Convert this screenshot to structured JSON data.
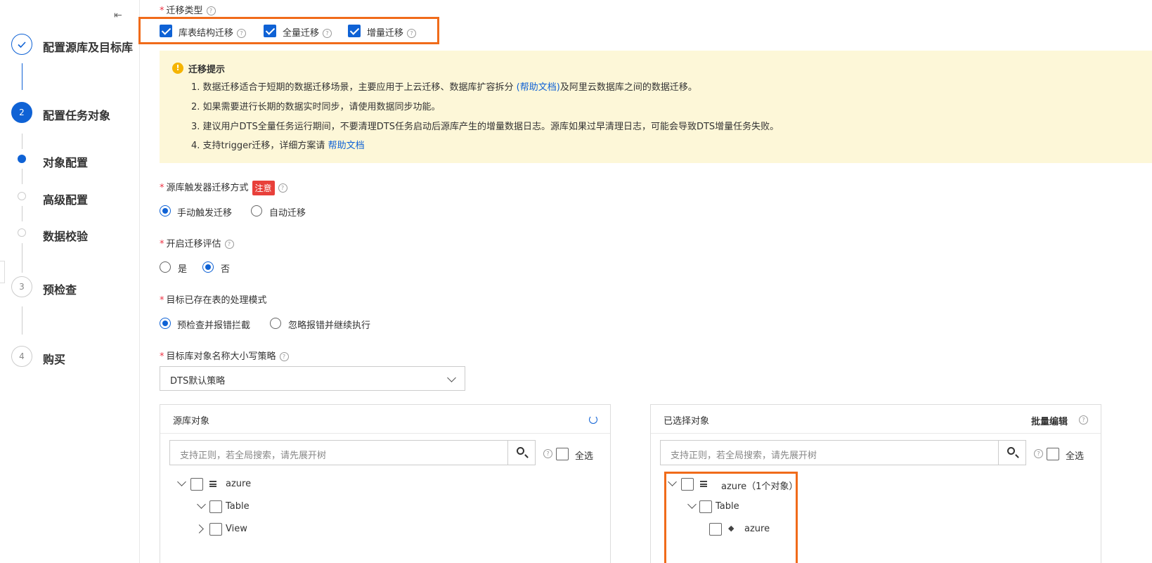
{
  "steps": {
    "step1": {
      "label": "配置源库及目标库",
      "icon": "check-icon"
    },
    "step2": {
      "number": "2",
      "label": "配置任务对象"
    },
    "sub1": {
      "label": "对象配置"
    },
    "sub2": {
      "label": "高级配置"
    },
    "sub3": {
      "label": "数据校验"
    },
    "step3": {
      "number": "3",
      "label": "预检查"
    },
    "step4": {
      "number": "4",
      "label": "购买"
    }
  },
  "collapse_icon": "⇤",
  "migration_type": {
    "label": "迁移类型",
    "options": [
      {
        "label": "库表结构迁移",
        "checked": true
      },
      {
        "label": "全量迁移",
        "checked": true
      },
      {
        "label": "增量迁移",
        "checked": true
      }
    ]
  },
  "notice": {
    "title": "迁移提示",
    "line1_a": "1. 数据迁移适合于短期的数据迁移场景，主要应用于上云迁移、数据库扩容拆分 ",
    "line1_link": "(帮助文档)",
    "line1_b": "及阿里云数据库之间的数据迁移。",
    "line2": "2. 如果需要进行长期的数据实时同步，请使用数据同步功能。",
    "line3": "3. 建议用户DTS全量任务运行期间，不要清理DTS任务启动后源库产生的增量数据日志。源库如果过早清理日志，可能会导致DTS增量任务失败。",
    "line4_a": "4. 支持trigger迁移，详细方案请  ",
    "line4_link": "帮助文档"
  },
  "trigger": {
    "label": "源库触发器迁移方式",
    "tag": "注意",
    "options": [
      {
        "label": "手动触发迁移",
        "selected": true
      },
      {
        "label": "自动迁移",
        "selected": false
      }
    ]
  },
  "assessment": {
    "label": "开启迁移评估",
    "options": [
      {
        "label": "是",
        "selected": false
      },
      {
        "label": "否",
        "selected": true
      }
    ]
  },
  "existing_table": {
    "label": "目标已存在表的处理模式",
    "options": [
      {
        "label": "预检查并报错拦截",
        "selected": true
      },
      {
        "label": "忽略报错并继续执行",
        "selected": false
      }
    ]
  },
  "case_policy": {
    "label": "目标库对象名称大小写策略",
    "value": "DTS默认策略"
  },
  "source_panel": {
    "title": "源库对象",
    "search_placeholder": "支持正则，若全局搜索，请先展开树",
    "select_all": "全选",
    "tree": [
      {
        "label": "azure",
        "expanded": true
      },
      {
        "label": "Table",
        "expanded": true
      },
      {
        "label": "View",
        "expanded": false
      }
    ]
  },
  "selected_panel": {
    "title": "已选择对象",
    "bulk_edit": "批量编辑",
    "search_placeholder": "支持正则，若全局搜索，请先展开树",
    "select_all": "全选",
    "tree": [
      {
        "label": "azure（1个对象）"
      },
      {
        "label": "Table"
      },
      {
        "label": "azure"
      }
    ]
  },
  "colors": {
    "primary": "#0f62d5",
    "highlight": "#f06b1a",
    "notice_bg": "#fdf7d8",
    "danger": "#e8403a"
  }
}
